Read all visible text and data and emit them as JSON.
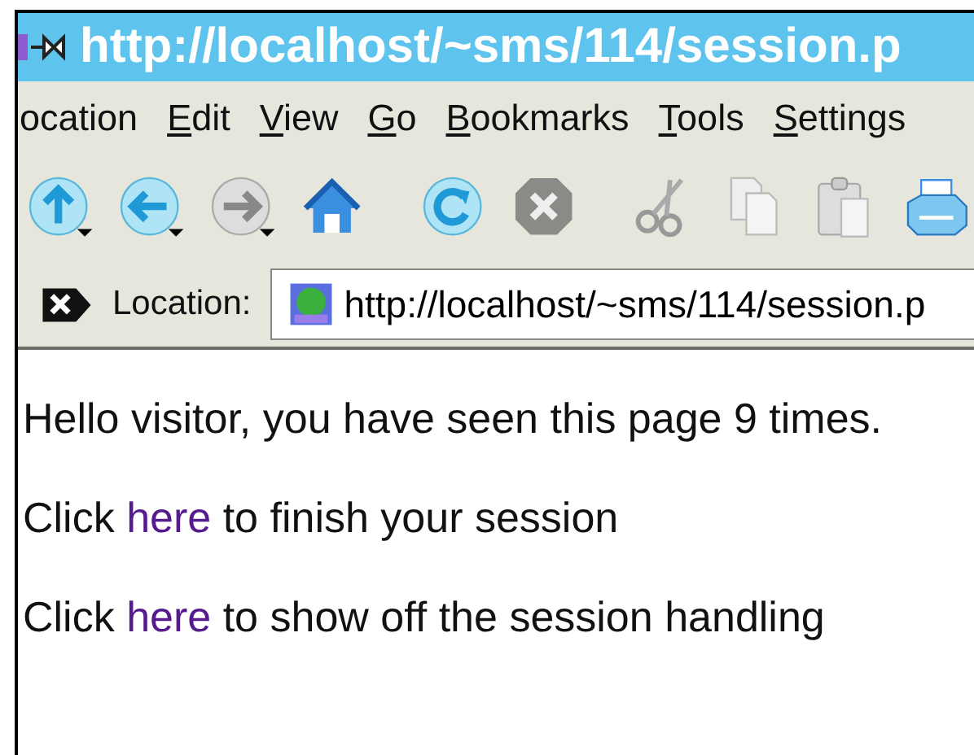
{
  "window": {
    "title": "http://localhost/~sms/114/session.p"
  },
  "menu": [
    "ocation",
    "Edit",
    "View",
    "Go",
    "Bookmarks",
    "Tools",
    "Settings"
  ],
  "toolbar": [
    {
      "kind": "up",
      "disabled": false
    },
    {
      "kind": "back",
      "disabled": false
    },
    {
      "kind": "forward",
      "disabled": true
    },
    {
      "kind": "home",
      "disabled": false
    },
    {
      "kind": "reload",
      "disabled": false
    },
    {
      "kind": "stop",
      "disabled": true
    },
    {
      "kind": "cut",
      "disabled": true
    },
    {
      "kind": "copy",
      "disabled": true
    },
    {
      "kind": "paste",
      "disabled": true
    },
    {
      "kind": "print",
      "disabled": false
    }
  ],
  "location": {
    "label": "Location:",
    "value": "http://localhost/~sms/114/session.p"
  },
  "content": [
    {
      "kind": "text",
      "text": "Hello visitor, you have seen this page 9 times."
    },
    {
      "kind": "link",
      "before": "Click ",
      "link": "here",
      "after": " to finish your session"
    },
    {
      "kind": "link",
      "before": "Click ",
      "link": "here",
      "after": " to show off the session handling"
    }
  ]
}
